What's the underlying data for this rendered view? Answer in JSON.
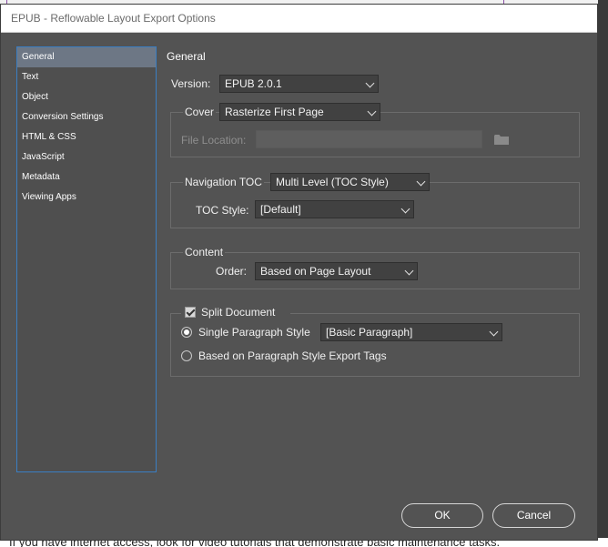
{
  "window": {
    "title": "EPUB - Reflowable Layout Export Options"
  },
  "background": {
    "footer_text": "If you have internet access, look for video tutorials that demonstrate basic maintenance tasks."
  },
  "sidebar": {
    "items": [
      {
        "label": "General"
      },
      {
        "label": "Text"
      },
      {
        "label": "Object"
      },
      {
        "label": "Conversion Settings"
      },
      {
        "label": "HTML & CSS"
      },
      {
        "label": "JavaScript"
      },
      {
        "label": "Metadata"
      },
      {
        "label": "Viewing Apps"
      }
    ],
    "selected": "General"
  },
  "panel": {
    "heading": "General",
    "version": {
      "label": "Version:",
      "value": "EPUB 2.0.1"
    },
    "cover": {
      "label": "Cover",
      "value": "Rasterize First Page",
      "file_location_label": "File Location:",
      "file_location_value": ""
    },
    "navigation": {
      "label": "Navigation TOC",
      "value": "Multi Level (TOC Style)",
      "toc_style_label": "TOC Style:",
      "toc_style_value": "[Default]"
    },
    "content": {
      "label": "Content",
      "order_label": "Order:",
      "order_value": "Based on Page Layout"
    },
    "split": {
      "label": "Split Document",
      "checked": true,
      "single_label": "Single Paragraph Style",
      "single_value": "[Basic Paragraph]",
      "tags_label": "Based on Paragraph Style Export Tags",
      "selected_option": "Single Paragraph Style"
    }
  },
  "buttons": {
    "ok": "OK",
    "cancel": "Cancel"
  },
  "colors": {
    "dialog_bg": "#535353",
    "selection": "#6d7785",
    "sidebar_border": "#3a7ec3"
  }
}
